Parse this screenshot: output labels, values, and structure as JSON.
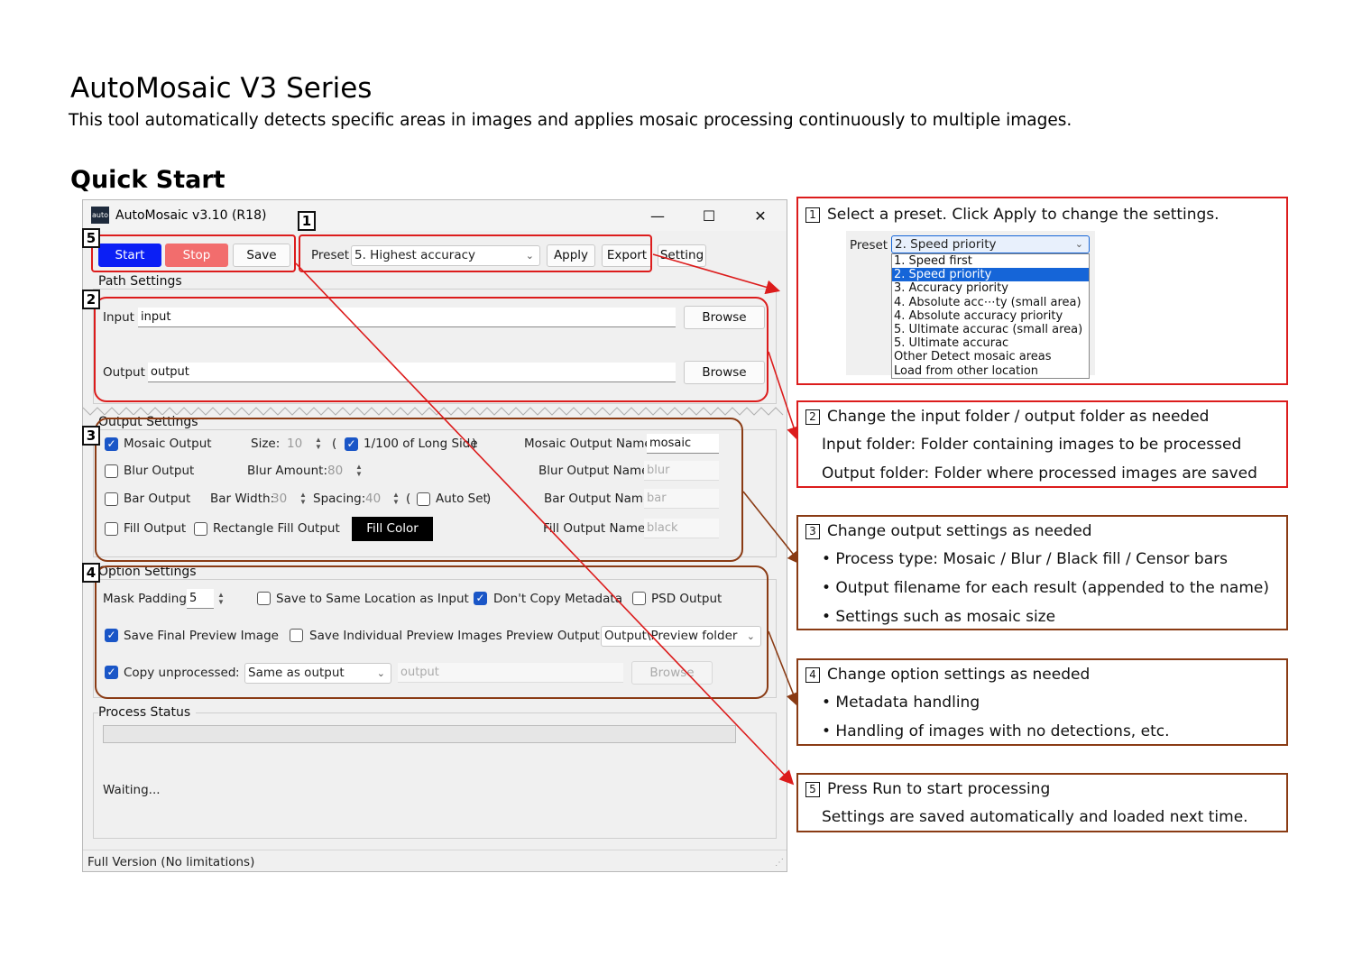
{
  "doc": {
    "title": "AutoMosaic V3 Series",
    "intro": "This tool automatically detects specific areas in images and applies mosaic processing continuously to multiple images.",
    "quick_start": "Quick Start"
  },
  "window": {
    "icon_text": "auto",
    "title": "AutoMosaic v3.10 (R18)",
    "minimize": "—",
    "maximize": "☐",
    "close": "✕",
    "status_bar": "Full Version (No limitations)"
  },
  "toolbar": {
    "start": "Start",
    "stop": "Stop",
    "save": "Save",
    "preset_label": "Preset",
    "preset_value": "5. Highest accuracy",
    "apply": "Apply",
    "export": "Export",
    "setting": "Setting"
  },
  "path": {
    "group": "Path Settings",
    "input_label": "Input",
    "input_value": "input",
    "output_label": "Output",
    "output_value": "output",
    "browse": "Browse"
  },
  "output": {
    "group": "Output Settings",
    "mosaic_output": "Mosaic Output",
    "size_label": "Size:",
    "size_value": "10",
    "paren_open": "(",
    "long_side": "1/100 of Long Side",
    "paren_close": ")",
    "mosaic_name_label": "Mosaic Output Name",
    "mosaic_name": "mosaic",
    "blur_output": "Blur Output",
    "blur_amount_label": "Blur Amount:",
    "blur_amount": "80",
    "blur_name_label": "Blur Output Name",
    "blur_name": "blur",
    "bar_output": "Bar Output",
    "bar_width_label": "Bar Width:",
    "bar_width": "30",
    "spacing_label": "Spacing:",
    "spacing": "40",
    "auto_set": "Auto Set",
    "bar_name_label": "Bar Output Name",
    "bar_name": "bar",
    "fill_output": "Fill Output",
    "rect_fill": "Rectangle Fill Output",
    "fill_color": "Fill Color",
    "fill_name_label": "Fill Output Name",
    "fill_name": "black"
  },
  "option": {
    "group": "Option Settings",
    "mask_padding_label": "Mask Padding:",
    "mask_padding": "5",
    "same_location": "Save to Same Location as Input",
    "dont_copy_meta": "Don't Copy Metadata",
    "psd_output": "PSD Output",
    "save_final_preview": "Save Final Preview Image",
    "save_individual_preview": "Save Individual Preview Images",
    "preview_output_label": "Preview Output:",
    "preview_output": "Output\\Preview folder",
    "copy_unprocessed": "Copy unprocessed",
    "colon": ":",
    "copy_target": "Same as output",
    "copy_path": "output",
    "browse": "Browse"
  },
  "status": {
    "group": "Process Status",
    "text": "Waiting...",
    "progress": 0
  },
  "markers": {
    "m1": "1",
    "m2": "2",
    "m3": "3",
    "m4": "4",
    "m5": "5"
  },
  "callouts": {
    "c1": {
      "num": "1",
      "line1": "Select a preset. Click Apply to change the settings.",
      "preset_label": "Preset",
      "preset_value": "2. Speed priority",
      "options": [
        "1. Speed first",
        "2. Speed priority",
        "3. Accuracy priority",
        "4. Absolute acc⋯ty (small area)",
        "4. Absolute accuracy priority",
        "5. Ultimate accurac (small area)",
        "5. Ultimate accurac",
        "Other Detect mosaic areas",
        "Load from other location"
      ],
      "selected_index": 1
    },
    "c2": {
      "num": "2",
      "line1": "Change the input folder / output folder as needed",
      "line2": "Input folder: Folder containing images to be processed",
      "line3": "Output folder: Folder where processed images are saved"
    },
    "c3": {
      "num": "3",
      "line1": "Change output settings as needed",
      "line2": "• Process type: Mosaic / Blur / Black fill / Censor bars",
      "line3": "• Output filename for each result (appended to the name)",
      "line4": "• Settings such as mosaic size"
    },
    "c4": {
      "num": "4",
      "line1": "Change option settings as needed",
      "line2": "• Metadata handling",
      "line3": "• Handling of images with no detections, etc."
    },
    "c5": {
      "num": "5",
      "line1": "Press Run to start processing",
      "line2": "Settings are saved automatically and loaded next time."
    }
  },
  "colors": {
    "red_annotation": "#dc1c1c",
    "brown_annotation": "#8a3b14",
    "start_button": "#0b1ff5",
    "stop_button": "#f26d6d",
    "checkbox_on": "#1a56c7"
  }
}
